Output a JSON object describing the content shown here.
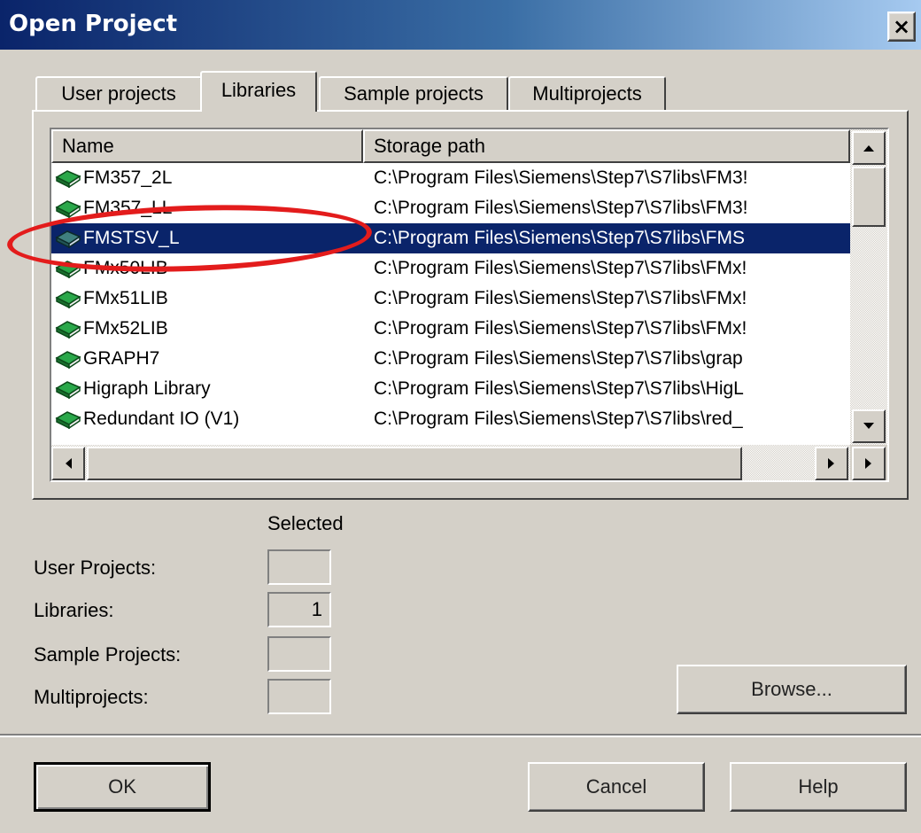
{
  "window": {
    "title": "Open Project",
    "close_glyph": "×"
  },
  "tabs": [
    {
      "label": "User projects",
      "active": false
    },
    {
      "label": "Libraries",
      "active": true
    },
    {
      "label": "Sample projects",
      "active": false
    },
    {
      "label": "Multiprojects",
      "active": false
    }
  ],
  "list": {
    "columns": [
      "Name",
      "Storage path"
    ],
    "rows": [
      {
        "name": "FM357_2L",
        "path": "C:\\Program Files\\Siemens\\Step7\\S7libs\\FM3!",
        "selected": false
      },
      {
        "name": "FM357_LL",
        "path": "C:\\Program Files\\Siemens\\Step7\\S7libs\\FM3!",
        "selected": false
      },
      {
        "name": "FMSTSV_L",
        "path": "C:\\Program Files\\Siemens\\Step7\\S7libs\\FMS",
        "selected": true
      },
      {
        "name": "FMx50LIB",
        "path": "C:\\Program Files\\Siemens\\Step7\\S7libs\\FMx!",
        "selected": false
      },
      {
        "name": "FMx51LIB",
        "path": "C:\\Program Files\\Siemens\\Step7\\S7libs\\FMx!",
        "selected": false
      },
      {
        "name": "FMx52LIB",
        "path": "C:\\Program Files\\Siemens\\Step7\\S7libs\\FMx!",
        "selected": false
      },
      {
        "name": "GRAPH7",
        "path": "C:\\Program Files\\Siemens\\Step7\\S7libs\\grap",
        "selected": false
      },
      {
        "name": "Higraph Library",
        "path": "C:\\Program Files\\Siemens\\Step7\\S7libs\\HigL",
        "selected": false
      },
      {
        "name": "Redundant IO (V1)",
        "path": "C:\\Program Files\\Siemens\\Step7\\S7libs\\red_",
        "selected": false
      }
    ]
  },
  "selection": {
    "heading": "Selected",
    "user_projects_label": "User Projects:",
    "user_projects_value": "",
    "libraries_label": "Libraries:",
    "libraries_value": "1",
    "sample_projects_label": "Sample Projects:",
    "sample_projects_value": "",
    "multiprojects_label": "Multiprojects:",
    "multiprojects_value": ""
  },
  "buttons": {
    "browse": "Browse...",
    "ok": "OK",
    "cancel": "Cancel",
    "help": "Help"
  },
  "colors": {
    "selection_bg": "#0a246a",
    "annotation": "#e31c1c",
    "icon_book": "#1f8a3a"
  },
  "icons": {
    "row_icon": "library-book-icon"
  }
}
